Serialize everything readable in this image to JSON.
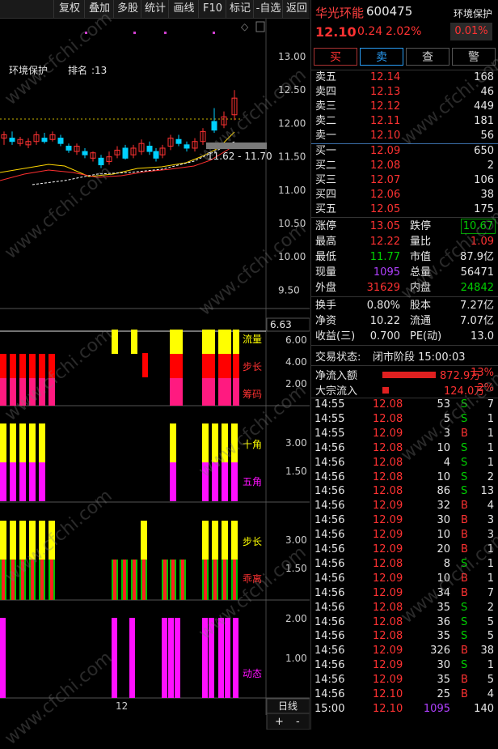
{
  "toolbar": {
    "items": [
      "复权",
      "叠加",
      "多股",
      "统计",
      "画线",
      "F10",
      "标记",
      "-自选",
      "返回"
    ]
  },
  "chart": {
    "block_name": "环境保护",
    "rank_label": "排名",
    "rank_value": ":13",
    "price_ticks": [
      "13.00",
      "12.50",
      "12.00",
      "11.50",
      "11.00",
      "10.50",
      "10.00",
      "9.50"
    ],
    "range_label": "11.62 - 11.70",
    "diamond_icon": "diamond-icon",
    "indicator_top_value": "6.63",
    "ind1_ticks": [
      "6.00",
      "4.00",
      "2.00"
    ],
    "ind1_labels": [
      "流量",
      "步长",
      "筹码"
    ],
    "ind2_ticks": [
      "3.00",
      "1.50"
    ],
    "ind2_labels": [
      "十角",
      "五角"
    ],
    "ind3_ticks": [
      "3.00",
      "1.50"
    ],
    "ind3_labels": [
      "步长",
      "乖离"
    ],
    "ind4_ticks": [
      "2.00",
      "1.00"
    ],
    "ind4_labels": [
      "动态"
    ],
    "x_label": "12",
    "period_label": "日线",
    "zoom_in": "+",
    "zoom_out": "-"
  },
  "quote": {
    "name": "华光环能",
    "code": "600475",
    "block": "环境保护",
    "price": "12.10",
    "change": "0.24",
    "change_pct": "2.02%",
    "block_pct": "0.01%",
    "buttons": [
      "买",
      "卖",
      "查",
      "警"
    ]
  },
  "asks": [
    {
      "label": "卖五",
      "price": "12.14",
      "vol": "168"
    },
    {
      "label": "卖四",
      "price": "12.13",
      "vol": "46"
    },
    {
      "label": "卖三",
      "price": "12.12",
      "vol": "449"
    },
    {
      "label": "卖二",
      "price": "12.11",
      "vol": "181"
    },
    {
      "label": "卖一",
      "price": "12.10",
      "vol": "56"
    }
  ],
  "bids": [
    {
      "label": "买一",
      "price": "12.09",
      "vol": "650"
    },
    {
      "label": "买二",
      "price": "12.08",
      "vol": "2"
    },
    {
      "label": "买三",
      "price": "12.07",
      "vol": "106"
    },
    {
      "label": "买四",
      "price": "12.06",
      "vol": "38"
    },
    {
      "label": "买五",
      "price": "12.05",
      "vol": "175"
    }
  ],
  "stats": [
    {
      "l1": "涨停",
      "v1": "13.05",
      "l2": "跌停",
      "v2": "10.67"
    },
    {
      "l1": "最高",
      "v1": "12.22",
      "l2": "量比",
      "v2": "1.09"
    },
    {
      "l1": "最低",
      "v1": "11.77",
      "l2": "市值",
      "v2": "87.9亿"
    },
    {
      "l1": "现量",
      "v1": "1095",
      "l2": "总量",
      "v2": "56471"
    },
    {
      "l1": "外盘",
      "v1": "31629",
      "l2": "内盘",
      "v2": "24842"
    }
  ],
  "stats2": [
    {
      "l1": "换手",
      "v1": "0.80%",
      "l2": "股本",
      "v2": "7.27亿"
    },
    {
      "l1": "净资",
      "v1": "10.22",
      "l2": "流通",
      "v2": "7.07亿"
    },
    {
      "l1": "收益(三)",
      "v1": "0.700",
      "l2": "PE(动)",
      "v2": "13.0"
    }
  ],
  "status": {
    "label": "交易状态:",
    "value": "闭市阶段 15:00:03",
    "net_inflow_label": "净流入额",
    "net_inflow_value": "872.9万",
    "net_inflow_pct": "13%",
    "bulk_inflow_label": "大宗流入",
    "bulk_inflow_value": "124.0万",
    "bulk_inflow_pct": "2%"
  },
  "ticks": [
    {
      "t": "14:55",
      "p": "12.08",
      "v": "53",
      "s": "S",
      "n": "7"
    },
    {
      "t": "14:55",
      "p": "12.08",
      "v": "5",
      "s": "S",
      "n": "1"
    },
    {
      "t": "14:55",
      "p": "12.09",
      "v": "3",
      "s": "B",
      "n": "1"
    },
    {
      "t": "14:56",
      "p": "12.08",
      "v": "10",
      "s": "S",
      "n": "1"
    },
    {
      "t": "14:56",
      "p": "12.08",
      "v": "4",
      "s": "S",
      "n": "1"
    },
    {
      "t": "14:56",
      "p": "12.08",
      "v": "10",
      "s": "S",
      "n": "2"
    },
    {
      "t": "14:56",
      "p": "12.08",
      "v": "86",
      "s": "S",
      "n": "13"
    },
    {
      "t": "14:56",
      "p": "12.09",
      "v": "32",
      "s": "B",
      "n": "4"
    },
    {
      "t": "14:56",
      "p": "12.09",
      "v": "30",
      "s": "B",
      "n": "3"
    },
    {
      "t": "14:56",
      "p": "12.09",
      "v": "10",
      "s": "B",
      "n": "3"
    },
    {
      "t": "14:56",
      "p": "12.09",
      "v": "20",
      "s": "B",
      "n": "1"
    },
    {
      "t": "14:56",
      "p": "12.08",
      "v": "8",
      "s": "S",
      "n": "1"
    },
    {
      "t": "14:56",
      "p": "12.09",
      "v": "10",
      "s": "B",
      "n": "1"
    },
    {
      "t": "14:56",
      "p": "12.09",
      "v": "34",
      "s": "B",
      "n": "7"
    },
    {
      "t": "14:56",
      "p": "12.08",
      "v": "35",
      "s": "S",
      "n": "2"
    },
    {
      "t": "14:56",
      "p": "12.08",
      "v": "36",
      "s": "S",
      "n": "5"
    },
    {
      "t": "14:56",
      "p": "12.08",
      "v": "35",
      "s": "S",
      "n": "5"
    },
    {
      "t": "14:56",
      "p": "12.09",
      "v": "326",
      "s": "B",
      "n": "38"
    },
    {
      "t": "14:56",
      "p": "12.09",
      "v": "30",
      "s": "S",
      "n": "1"
    },
    {
      "t": "14:56",
      "p": "12.09",
      "v": "35",
      "s": "B",
      "n": "5"
    },
    {
      "t": "14:56",
      "p": "12.10",
      "v": "25",
      "s": "B",
      "n": "4"
    },
    {
      "t": "15:00",
      "p": "12.10",
      "v": "1095",
      "s": "",
      "n": "140"
    }
  ],
  "watermark": "www.cfchi.com"
}
